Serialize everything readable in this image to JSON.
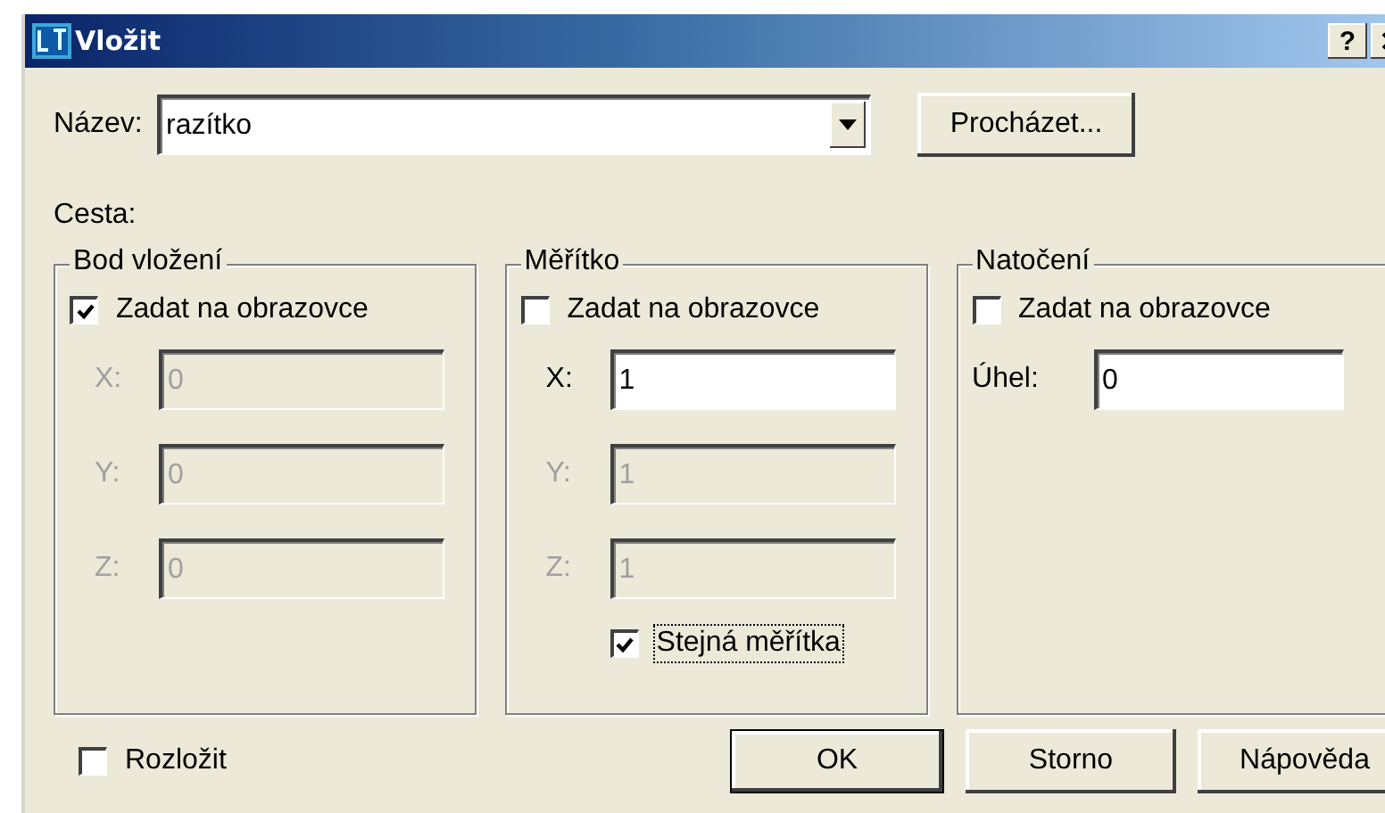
{
  "window": {
    "title": "Vložit",
    "help_button": "?"
  },
  "name": {
    "label": "Název:",
    "value": "razítko"
  },
  "browse_button": "Procházet...",
  "path": {
    "label": "Cesta:"
  },
  "groups": [
    {
      "title": "Bod vložení",
      "checkbox": {
        "label": "Zadat na obrazovce",
        "checked": true
      },
      "fields": [
        {
          "label": "X:",
          "value": "0",
          "disabled": true
        },
        {
          "label": "Y:",
          "value": "0",
          "disabled": true
        },
        {
          "label": "Z:",
          "value": "0",
          "disabled": true
        }
      ]
    },
    {
      "title": "Měřítko",
      "checkbox": {
        "label": "Zadat na obrazovce",
        "checked": false
      },
      "fields": [
        {
          "label": "X:",
          "value": "1",
          "disabled": false
        },
        {
          "label": "Y:",
          "value": "1",
          "disabled": true
        },
        {
          "label": "Z:",
          "value": "1",
          "disabled": true
        }
      ],
      "extra_checkbox": {
        "label": "Stejná měřítka",
        "checked": true,
        "focused": true
      }
    },
    {
      "title": "Natočení",
      "checkbox": {
        "label": "Zadat na obrazovce",
        "checked": false
      },
      "fields": [
        {
          "label": "Úhel:",
          "value": "0",
          "disabled": false
        }
      ]
    }
  ],
  "explode": {
    "label": "Rozložit",
    "checked": false
  },
  "buttons": [
    {
      "label": "OK",
      "default": true
    },
    {
      "label": "Storno",
      "default": false
    },
    {
      "label": "Nápověda",
      "default": false
    }
  ]
}
